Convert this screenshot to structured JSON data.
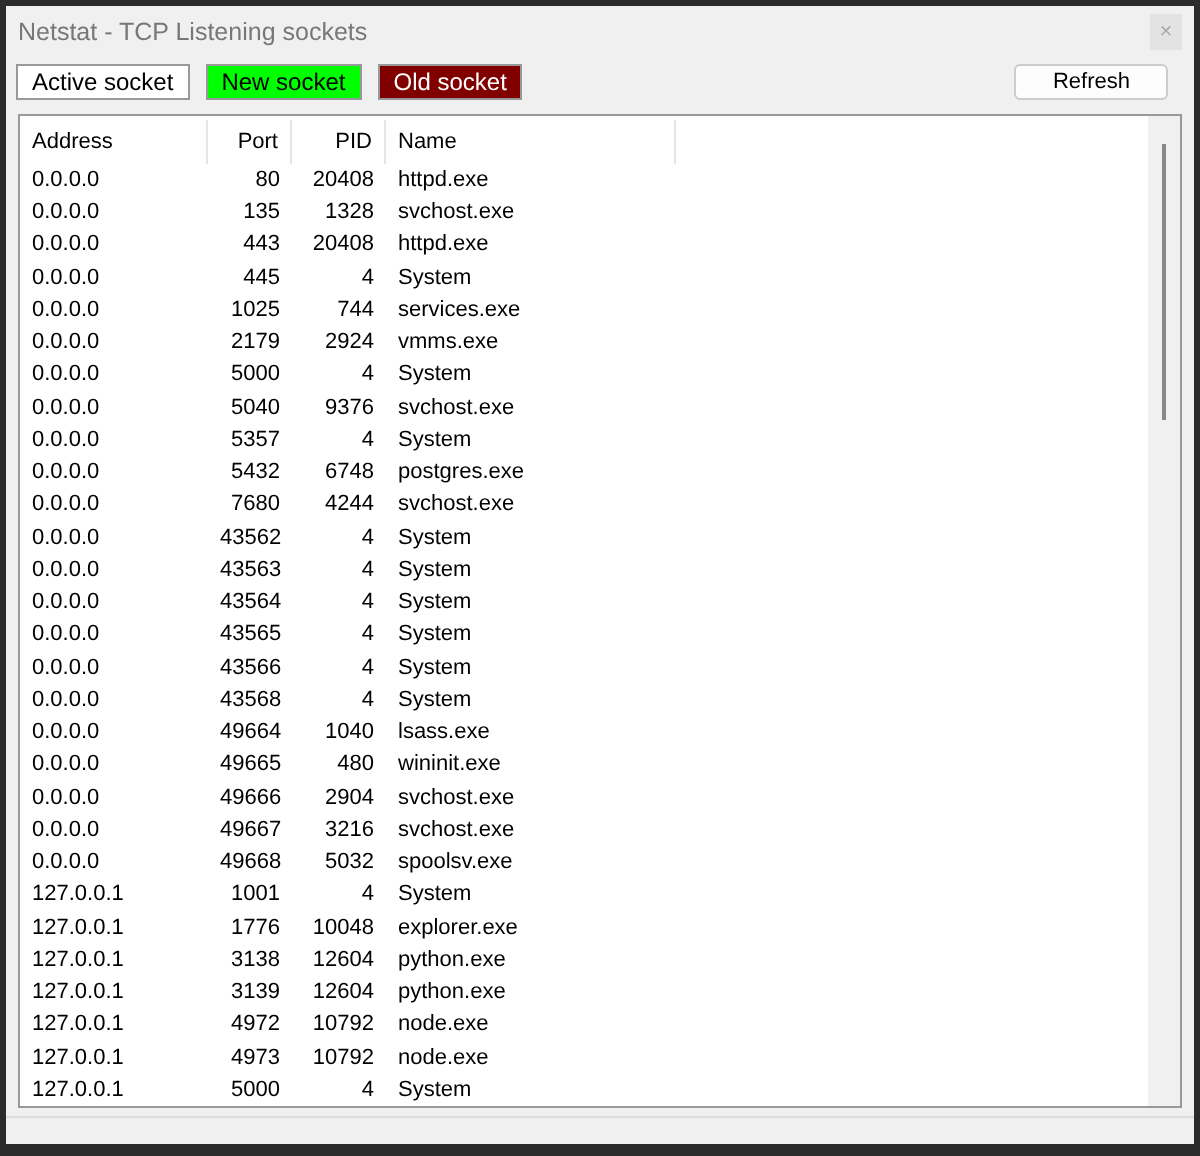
{
  "window": {
    "title": "Netstat - TCP Listening sockets",
    "close": "×"
  },
  "legend": [
    {
      "label": "Active socket",
      "color": "#ffffff"
    },
    {
      "label": "New socket",
      "color": "#00ff00"
    },
    {
      "label": "Old socket",
      "color": "#800000"
    }
  ],
  "refresh_button": "Refresh",
  "table": {
    "columns": [
      "Address",
      "Port",
      "PID",
      "Name"
    ],
    "rows": [
      [
        "0.0.0.0",
        "80",
        "20408",
        "httpd.exe"
      ],
      [
        "0.0.0.0",
        "135",
        "1328",
        "svchost.exe"
      ],
      [
        "0.0.0.0",
        "443",
        "20408",
        "httpd.exe"
      ],
      [
        "0.0.0.0",
        "445",
        "4",
        "System"
      ],
      [
        "0.0.0.0",
        "1025",
        "744",
        "services.exe"
      ],
      [
        "0.0.0.0",
        "2179",
        "2924",
        "vmms.exe"
      ],
      [
        "0.0.0.0",
        "5000",
        "4",
        "System"
      ],
      [
        "0.0.0.0",
        "5040",
        "9376",
        "svchost.exe"
      ],
      [
        "0.0.0.0",
        "5357",
        "4",
        "System"
      ],
      [
        "0.0.0.0",
        "5432",
        "6748",
        "postgres.exe"
      ],
      [
        "0.0.0.0",
        "7680",
        "4244",
        "svchost.exe"
      ],
      [
        "0.0.0.0",
        "43562",
        "4",
        "System"
      ],
      [
        "0.0.0.0",
        "43563",
        "4",
        "System"
      ],
      [
        "0.0.0.0",
        "43564",
        "4",
        "System"
      ],
      [
        "0.0.0.0",
        "43565",
        "4",
        "System"
      ],
      [
        "0.0.0.0",
        "43566",
        "4",
        "System"
      ],
      [
        "0.0.0.0",
        "43568",
        "4",
        "System"
      ],
      [
        "0.0.0.0",
        "49664",
        "1040",
        "lsass.exe"
      ],
      [
        "0.0.0.0",
        "49665",
        "480",
        "wininit.exe"
      ],
      [
        "0.0.0.0",
        "49666",
        "2904",
        "svchost.exe"
      ],
      [
        "0.0.0.0",
        "49667",
        "3216",
        "svchost.exe"
      ],
      [
        "0.0.0.0",
        "49668",
        "5032",
        "spoolsv.exe"
      ],
      [
        "127.0.0.1",
        "1001",
        "4",
        "System"
      ],
      [
        "127.0.0.1",
        "1776",
        "10048",
        "explorer.exe"
      ],
      [
        "127.0.0.1",
        "3138",
        "12604",
        "python.exe"
      ],
      [
        "127.0.0.1",
        "3139",
        "12604",
        "python.exe"
      ],
      [
        "127.0.0.1",
        "4972",
        "10792",
        "node.exe"
      ],
      [
        "127.0.0.1",
        "4973",
        "10792",
        "node.exe"
      ],
      [
        "127.0.0.1",
        "5000",
        "4",
        "System"
      ]
    ]
  }
}
